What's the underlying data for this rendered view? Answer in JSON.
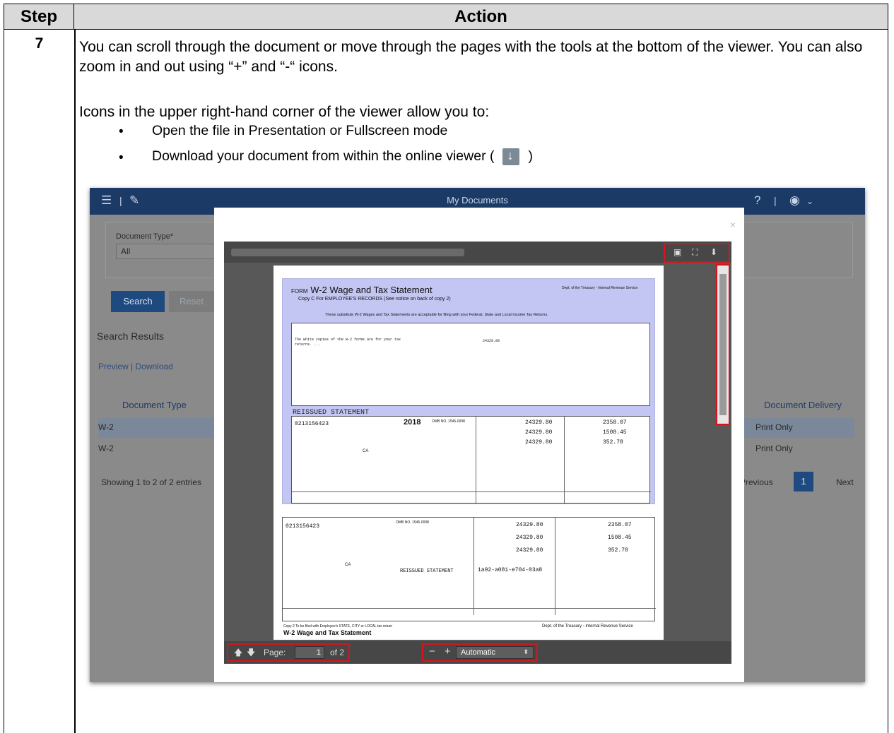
{
  "header": {
    "step": "Step",
    "action": "Action"
  },
  "step_number": "7",
  "para1": "You can scroll through the document or move through the pages with the tools at the bottom of the viewer. You can also zoom in and out using “+” and “-“ icons.",
  "para2": "Icons in the upper right-hand corner of the viewer allow you to:",
  "bullets": [
    "Open the file in Presentation or Fullscreen mode",
    "Download your document from within the online viewer ("
  ],
  "bullet2_suffix": ")",
  "screenshot": {
    "app_title": "My Documents",
    "doc_type_label": "Document Type*",
    "doc_type_value": "All",
    "search_btn": "Search",
    "reset_btn": "Reset",
    "search_results": "Search Results",
    "preview_link": "Preview",
    "download_link": "Download",
    "col_doc_type": "Document Type",
    "col_doc_delivery": "Document Delivery",
    "rows": [
      {
        "type": "W-2",
        "delivery": "Print Only"
      },
      {
        "type": "W-2",
        "delivery": "Print Only"
      }
    ],
    "showing": "Showing 1 to 2 of 2 entries",
    "previous": "Previous",
    "page_num": "1",
    "next": "Next",
    "viewer": {
      "page_label": "Page:",
      "page_value": "1",
      "page_of": "of 2",
      "zoom": "Automatic"
    },
    "form": {
      "title_prefix": "FORM",
      "title": "W-2 Wage and Tax Statement",
      "copy_c": "Copy C For EMPLOYEE'S RECORDS (See notice on back of copy 2)",
      "dept": "Dept. of the Treasury - Internal Revenue Service",
      "substitute": "These substitute W-2 Wages and Tax Statements are acceptable for filing with your Federal, State and Local Income Tax Returns.",
      "reissued": "REISSUED STATEMENT",
      "year": "2018",
      "omb": "OMB NO. 1545-0008",
      "control": "0213156423",
      "wages": "24329.80",
      "fed_tax": "2358.07",
      "ss_tax": "1508.45",
      "med_tax": "352.78",
      "state": "CA",
      "verif": "1a92-a081-e704-03a8",
      "footer_title": "W-2  Wage and Tax Statement",
      "footer_copy": "Copy 2  To be filed with Employee's STATE, CITY or LOCAL tax return",
      "footer_dept": "Dept. of the Treasury - Internal Revenue Service"
    }
  }
}
